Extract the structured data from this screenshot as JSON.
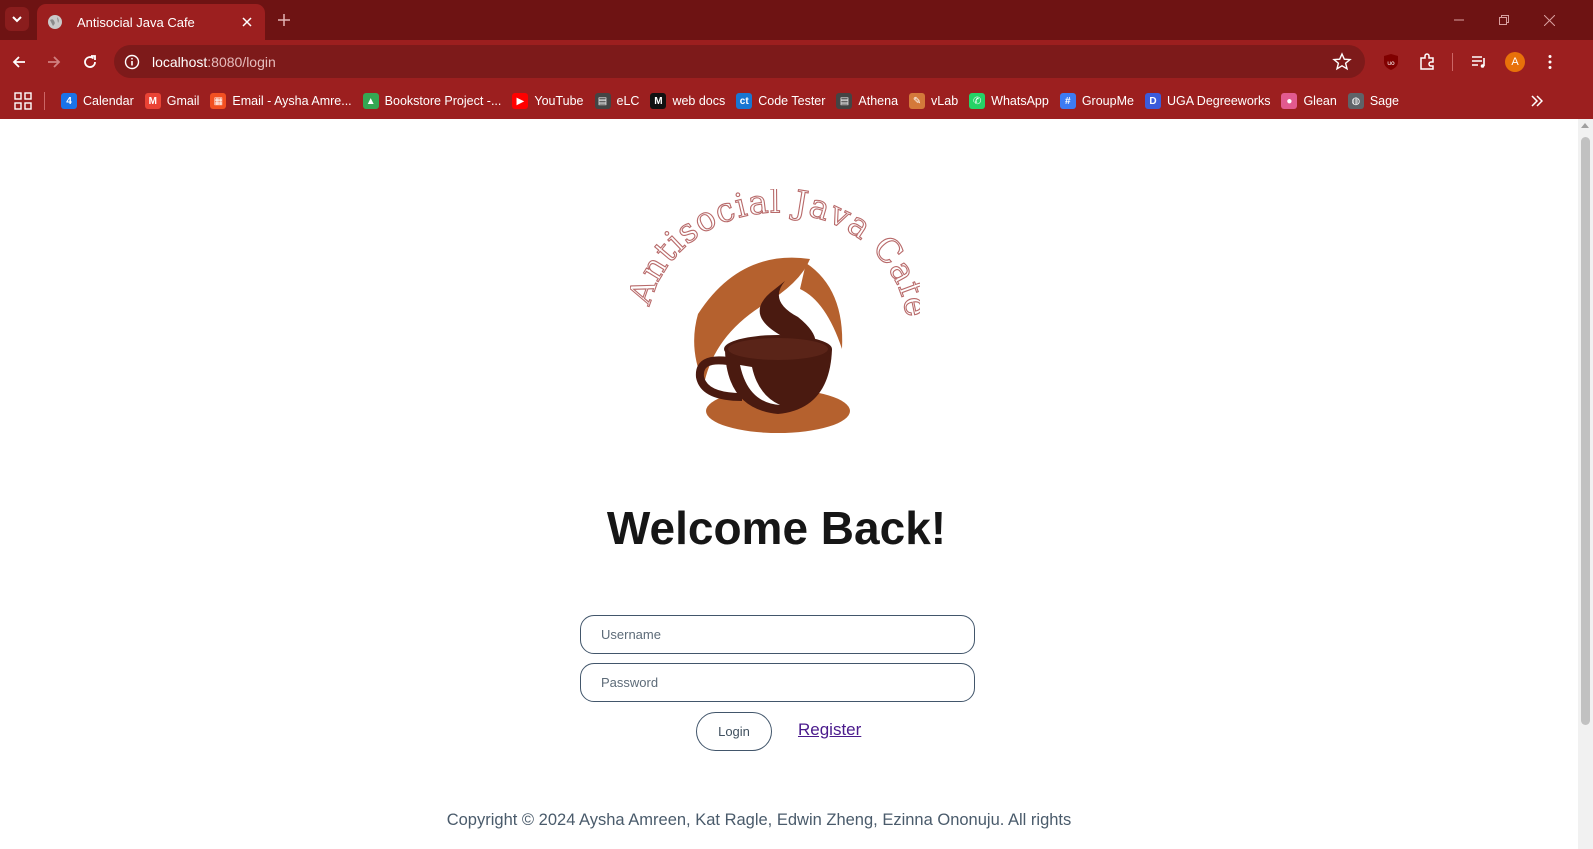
{
  "browser": {
    "tab_title": "Antisocial Java Cafe",
    "url_host": "localhost",
    "url_path": ":8080/login",
    "profile_initial": "A",
    "theme_color": "#9c1f1f"
  },
  "bookmarks": [
    {
      "label": "Calendar",
      "icon": "calendar-icon",
      "color": "#1a73e8",
      "glyph": "4"
    },
    {
      "label": "Gmail",
      "icon": "gmail-icon",
      "color": "#ea4335",
      "glyph": "M"
    },
    {
      "label": "Email - Aysha Amre...",
      "icon": "microsoft-icon",
      "color": "#f25022",
      "glyph": "▦"
    },
    {
      "label": "Bookstore Project -...",
      "icon": "drive-icon",
      "color": "#34a853",
      "glyph": "▲"
    },
    {
      "label": "YouTube",
      "icon": "youtube-icon",
      "color": "#ff0000",
      "glyph": "▶"
    },
    {
      "label": "eLC",
      "icon": "elc-icon",
      "color": "#444444",
      "glyph": "▤"
    },
    {
      "label": "web docs",
      "icon": "mdn-icon",
      "color": "#111111",
      "glyph": "M"
    },
    {
      "label": "Code Tester",
      "icon": "code-tester-icon",
      "color": "#1976d2",
      "glyph": "ct"
    },
    {
      "label": "Athena",
      "icon": "athena-icon",
      "color": "#444444",
      "glyph": "▤"
    },
    {
      "label": "vLab",
      "icon": "vlab-icon",
      "color": "#d4793a",
      "glyph": "✎"
    },
    {
      "label": "WhatsApp",
      "icon": "whatsapp-icon",
      "color": "#25d366",
      "glyph": "✆"
    },
    {
      "label": "GroupMe",
      "icon": "groupme-icon",
      "color": "#3d7bf2",
      "glyph": "#"
    },
    {
      "label": "UGA Degreeworks",
      "icon": "degreeworks-icon",
      "color": "#3b5bdb",
      "glyph": "D"
    },
    {
      "label": "Glean",
      "icon": "glean-icon",
      "color": "#e25a8f",
      "glyph": "●"
    },
    {
      "label": "Sage",
      "icon": "sage-icon",
      "color": "#5f6368",
      "glyph": "◍"
    }
  ],
  "page": {
    "logo_text": "Antisocial Java Cafe",
    "heading": "Welcome Back!",
    "username_placeholder": "Username",
    "password_placeholder": "Password",
    "login_label": "Login",
    "register_label": "Register",
    "copyright": "Copyright © 2024 Aysha Amreen, Kat Ragle, Edwin Zheng, Ezinna Ononuju. All rights"
  }
}
